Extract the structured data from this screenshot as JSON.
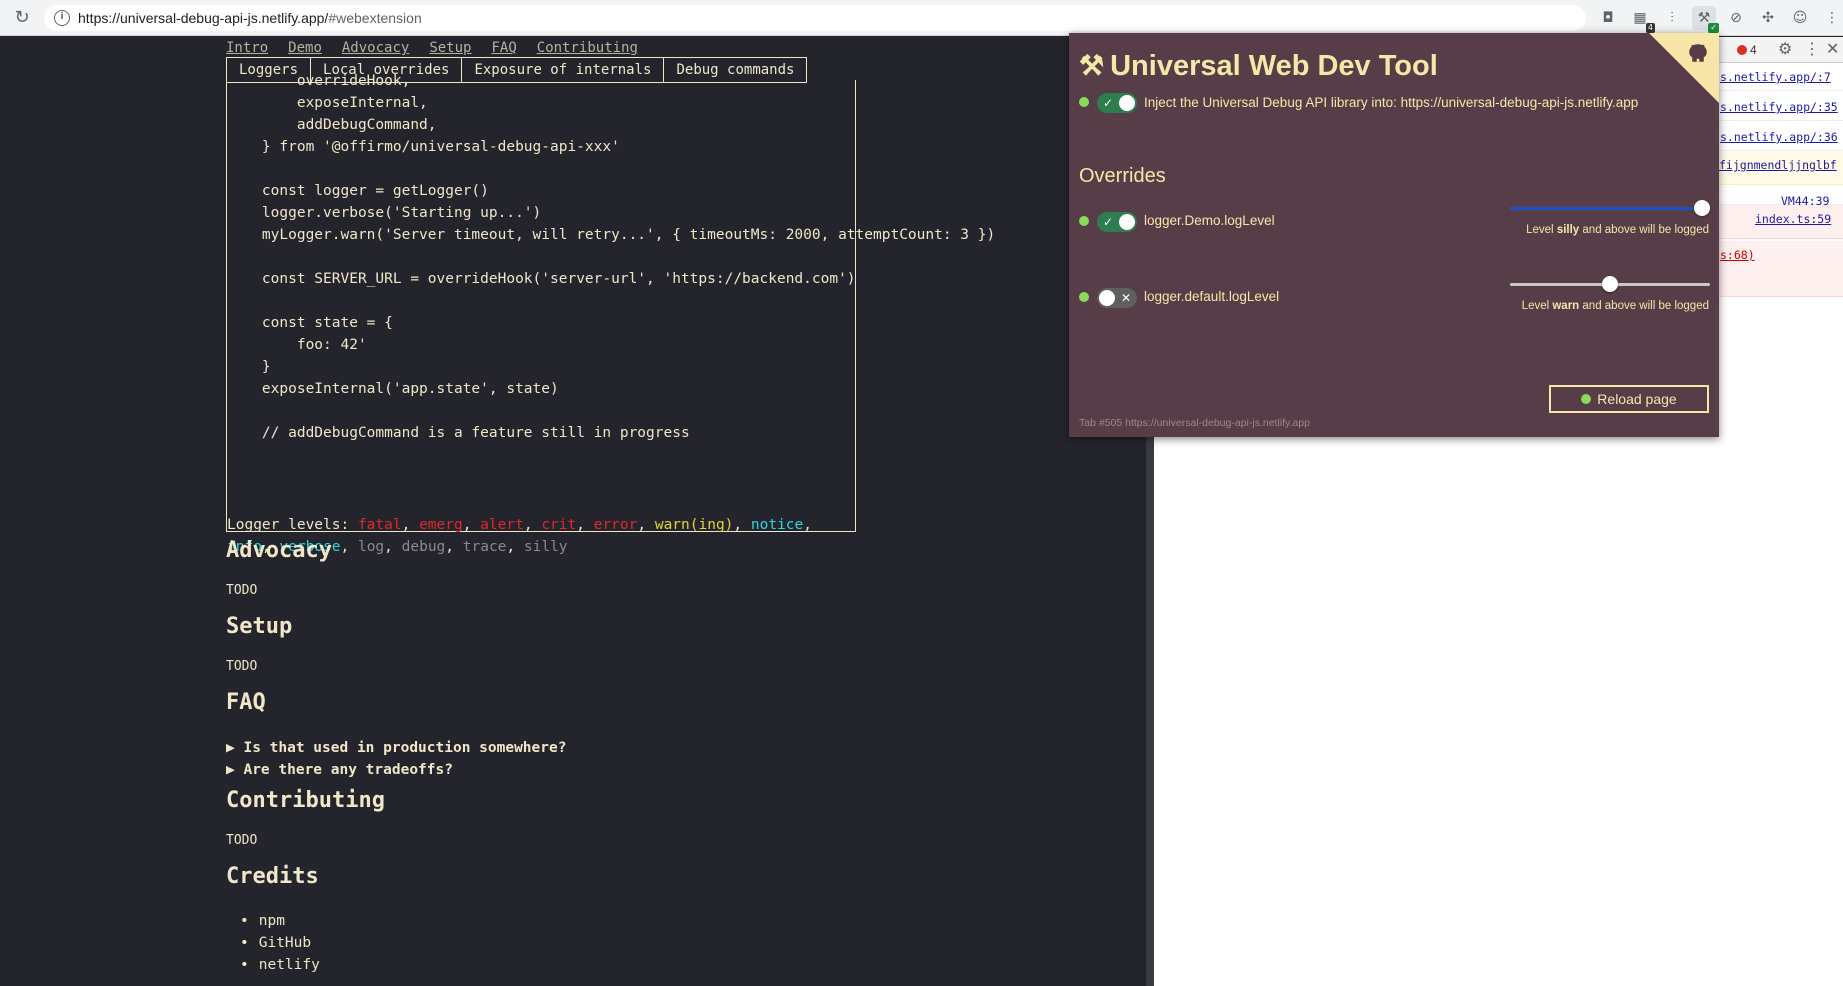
{
  "browser": {
    "url_host": "https://universal-debug-api-js.netlify.app/",
    "url_rest": "#webextension",
    "extensions": [
      {
        "icon": "pocket-icon",
        "glyph": "◘",
        "badge": ""
      },
      {
        "icon": "green-ext-icon",
        "glyph": "▦",
        "badge": "4"
      },
      {
        "icon": "bars-ext-icon",
        "glyph": "⫶",
        "badge": ""
      },
      {
        "icon": "dev-tool-ext-icon",
        "glyph": "⚒",
        "badge": "✓"
      },
      {
        "icon": "slash-ext-icon",
        "glyph": "⊘",
        "badge": ""
      },
      {
        "icon": "puzzle-icon",
        "glyph": "✣",
        "badge": ""
      },
      {
        "icon": "profile-icon",
        "glyph": "☺",
        "badge": ""
      },
      {
        "icon": "kebab-menu-icon",
        "glyph": "⋮",
        "badge": ""
      }
    ]
  },
  "page": {
    "nav": [
      "Intro",
      "Demo",
      "Advocacy",
      "Setup",
      "FAQ",
      "Contributing"
    ],
    "tabs": [
      "Loggers",
      "Local overrides",
      "Exposure of internals",
      "Debug commands"
    ],
    "code_lines": [
      "        overrideHook,",
      "        exposeInternal,",
      "        addDebugCommand,",
      "    } from '@offirmo/universal-debug-api-xxx'",
      "",
      "    const logger = getLogger()",
      "    logger.verbose('Starting up...')",
      "    myLogger.warn('Server timeout, will retry...', { timeoutMs: 2000, attemptCount: 3 })",
      "",
      "    const SERVER_URL = overrideHook('server-url', 'https://backend.com')",
      "",
      "    const state = {",
      "        foo: 42'",
      "    }",
      "    exposeInternal('app.state', state)",
      "",
      "    // addDebugCommand is a feature still in progress"
    ],
    "levels_prefix": "Logger levels: ",
    "levels": [
      {
        "name": "fatal",
        "color": "red"
      },
      {
        "name": "emerg",
        "color": "red"
      },
      {
        "name": "alert",
        "color": "red"
      },
      {
        "name": "crit",
        "color": "red"
      },
      {
        "name": "error",
        "color": "red"
      },
      {
        "name": "warn(ing)",
        "color": "yellow"
      },
      {
        "name": "notice",
        "color": "cyan"
      },
      {
        "name": "info",
        "color": "cyan"
      },
      {
        "name": "verbose",
        "color": "cyan"
      },
      {
        "name": "log",
        "color": "gray"
      },
      {
        "name": "debug",
        "color": "gray"
      },
      {
        "name": "trace",
        "color": "gray"
      },
      {
        "name": "silly",
        "color": "gray"
      }
    ],
    "advocacy": {
      "heading": "Advocacy",
      "body": "TODO"
    },
    "setup": {
      "heading": "Setup",
      "body": "TODO"
    },
    "faq": {
      "heading": "FAQ",
      "items": [
        "▶ Is that used in production somewhere?",
        "▶ Are there any tradeoffs?"
      ]
    },
    "contributing": {
      "heading": "Contributing",
      "body": "TODO"
    },
    "credits": {
      "heading": "Credits",
      "items": [
        "npm",
        "GitHub",
        "netlify"
      ]
    }
  },
  "devtools": {
    "error_count": "4",
    "rows": [
      {
        "text": "s.netlify.app/:7",
        "kind": "plain"
      },
      {
        "text": "s.netlify.app/:35",
        "kind": "plain"
      },
      {
        "text": "s.netlify.app/:36",
        "kind": "plain"
      },
      {
        "text": "fijgnmendljjnglbf",
        "kind": "warn"
      },
      {
        "text": "VM44:39",
        "kind": "plain"
      },
      {
        "text": "index.ts:59",
        "kind": "err"
      },
      {
        "text": "s:68)",
        "kind": "err"
      }
    ]
  },
  "popup": {
    "title": "Universal Web Dev Tool",
    "title_icon": "⚒",
    "inject_label": "Inject the Universal Debug API library into: https://universal-debug-api-js.netlify.app",
    "inject_enabled": true,
    "overrides_heading": "Overrides",
    "overrides": [
      {
        "key": "logger.Demo.logLevel",
        "enabled": true,
        "level_fraction": 1.0,
        "caption_pre": "Level ",
        "caption_level": "silly",
        "caption_post": " and above will be logged"
      },
      {
        "key": "logger.default.logLevel",
        "enabled": false,
        "level_fraction": 0.5,
        "caption_pre": "Level ",
        "caption_level": "warn",
        "caption_post": " and above will be logged"
      }
    ],
    "reload_label": "Reload page",
    "footer": "Tab #505 https://universal-debug-api-js.netlify.app"
  }
}
